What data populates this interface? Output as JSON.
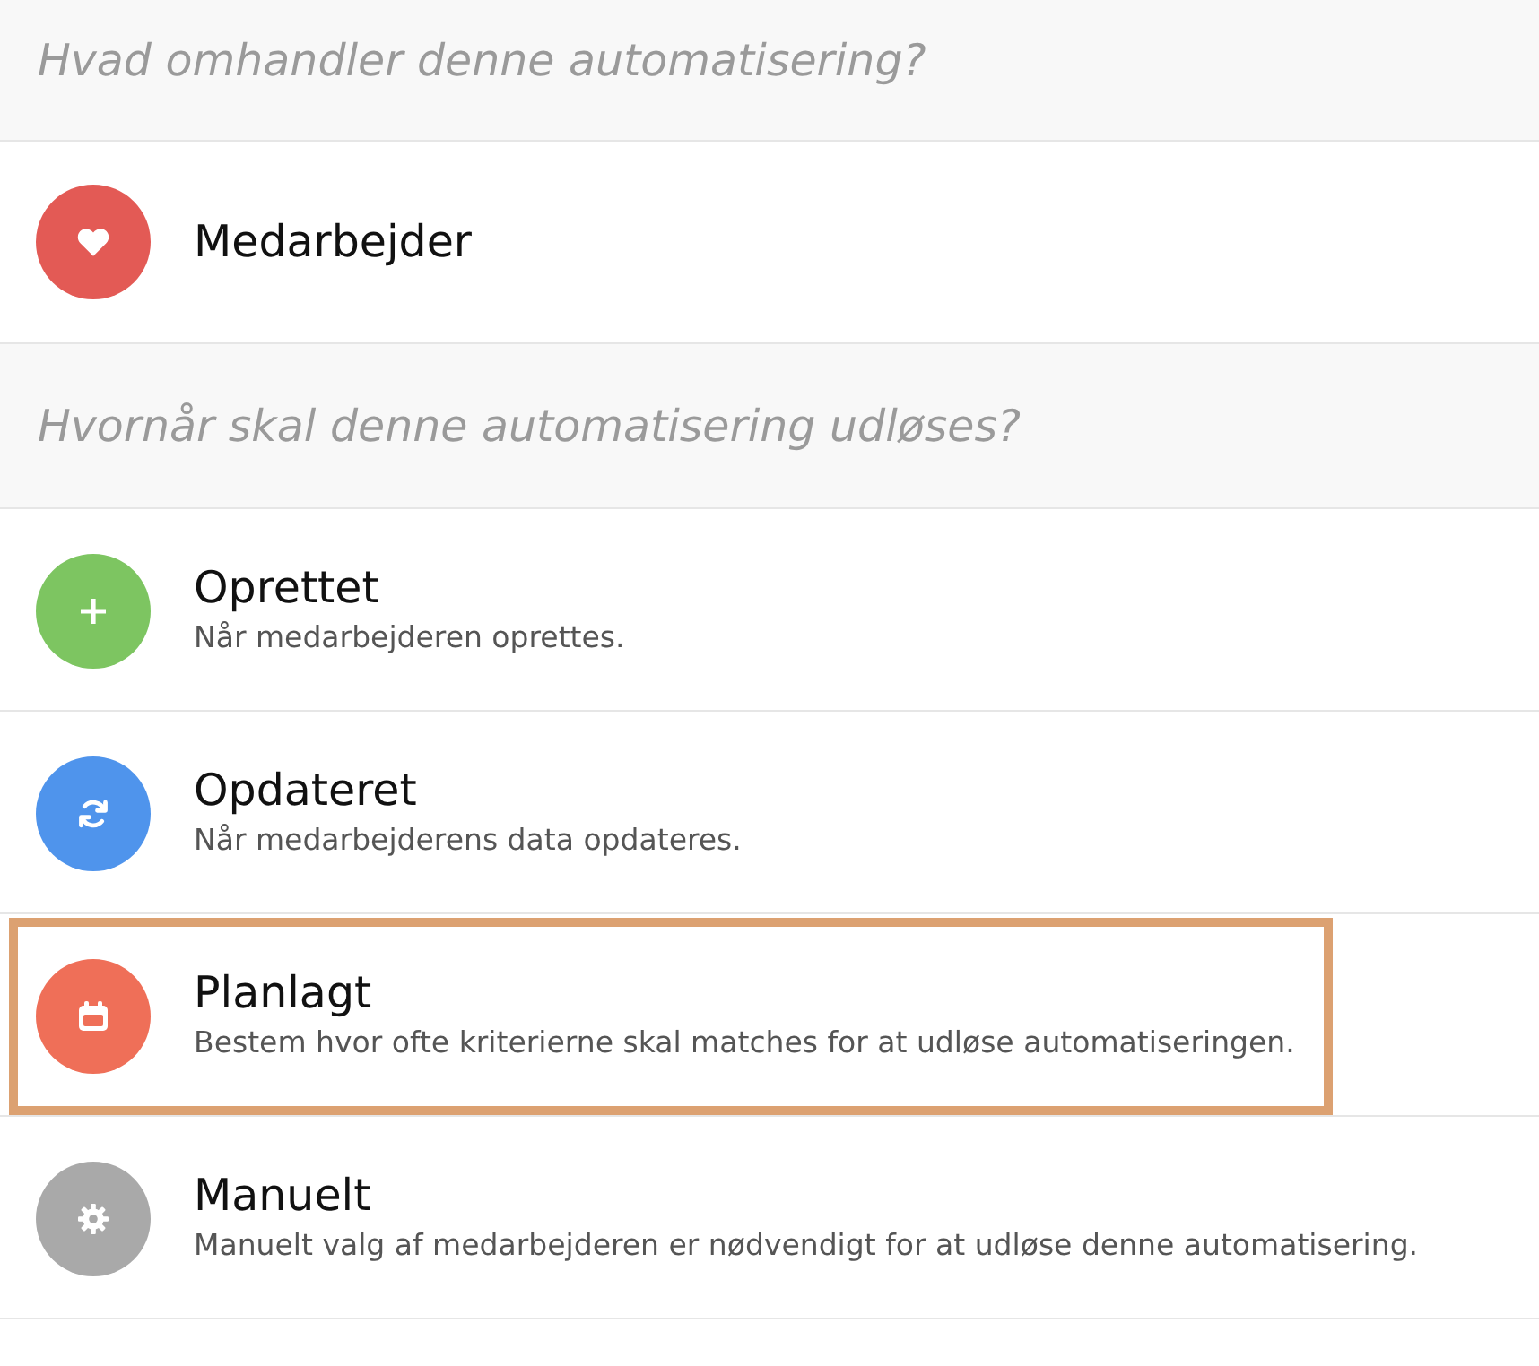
{
  "subject_section": {
    "heading": "Hvad omhandler denne automatisering?",
    "item": {
      "title": "Medarbejder"
    }
  },
  "trigger_section": {
    "heading": "Hvornår skal denne automatisering udløses?",
    "triggers": [
      {
        "title": "Oprettet",
        "description": "Når medarbejderen oprettes.",
        "color": "#7dc561",
        "selected": false
      },
      {
        "title": "Opdateret",
        "description": "Når medarbejderens data opdateres.",
        "color": "#4f94ec",
        "selected": false
      },
      {
        "title": "Planlagt",
        "description": "Bestem hvor ofte kriterierne skal matches for at udløse automatiseringen.",
        "color": "#ef6f58",
        "selected": true
      },
      {
        "title": "Manuelt",
        "description": "Manuelt valg af medarbejderen er nødvendigt for at udløse denne automatisering.",
        "color": "#a9a9a9",
        "selected": false
      }
    ]
  }
}
